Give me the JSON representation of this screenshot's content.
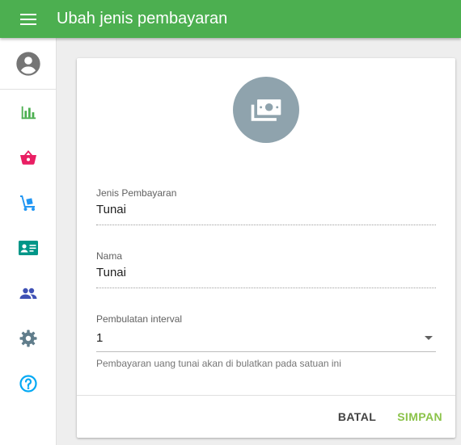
{
  "appbar": {
    "title": "Ubah jenis pembayaran"
  },
  "sidebar": {
    "items": [
      {
        "icon": "account-circle-icon",
        "color": "#757575"
      },
      {
        "icon": "bar-chart-icon",
        "color": "#4caf50"
      },
      {
        "icon": "shopping-basket-icon",
        "color": "#e91e63"
      },
      {
        "icon": "dolly-icon",
        "color": "#2196f3"
      },
      {
        "icon": "contact-card-icon",
        "color": "#009688"
      },
      {
        "icon": "people-icon",
        "color": "#3f51b5"
      },
      {
        "icon": "settings-gear-icon",
        "color": "#607d8b"
      },
      {
        "icon": "help-circle-icon",
        "color": "#03a9f4"
      }
    ]
  },
  "form": {
    "header_icon": "money-icon",
    "header_icon_bg": "#8fa3ad",
    "payment_type": {
      "label": "Jenis Pembayaran",
      "value": "Tunai"
    },
    "name": {
      "label": "Nama",
      "value": "Tunai"
    },
    "rounding": {
      "label": "Pembulatan interval",
      "value": "1",
      "helper": "Pembayaran uang tunai akan di bulatkan pada satuan ini"
    }
  },
  "actions": {
    "cancel_label": "BATAL",
    "save_label": "SIMPAN"
  },
  "colors": {
    "appbar": "#4caf50",
    "save": "#8bc34a"
  }
}
